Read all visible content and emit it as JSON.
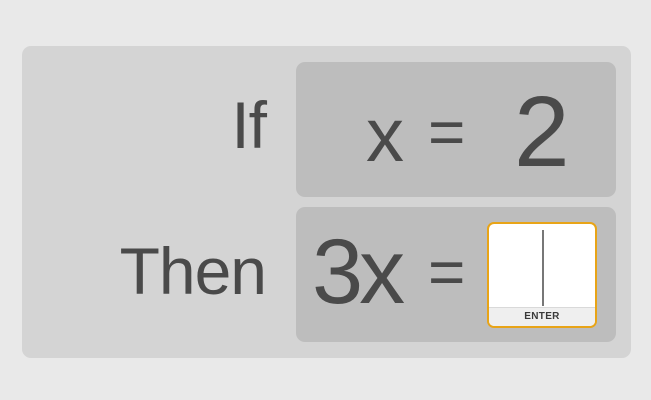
{
  "problem": {
    "if_label": "If",
    "then_label": "Then",
    "given": {
      "variable": "x",
      "equals": "=",
      "value": "2"
    },
    "question": {
      "expression": "3x",
      "equals": "=",
      "answer_value": "",
      "enter_label": "ENTER"
    }
  },
  "colors": {
    "background": "#e9e9e9",
    "panel": "#d4d4d4",
    "equation_box": "#bdbdbd",
    "text": "#4a4a4a",
    "input_border": "#e8a417"
  }
}
